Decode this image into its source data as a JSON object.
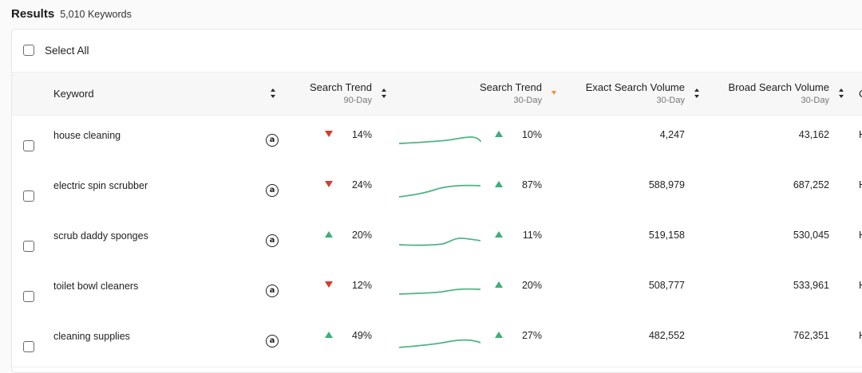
{
  "results": {
    "title": "Results",
    "count": "5,010 Keywords"
  },
  "select_all_label": "Select All",
  "columns": {
    "keyword": "Keyword",
    "trend90": {
      "label": "Search Trend",
      "sub": "90-Day"
    },
    "trend30": {
      "label": "Search Trend",
      "sub": "30-Day"
    },
    "exact": {
      "label": "Exact Search Volume",
      "sub": "30-Day"
    },
    "broad": {
      "label": "Broad Search Volume",
      "sub": "30-Day"
    },
    "cut_header": "C"
  },
  "amazon_glyph": "a",
  "icons": {
    "marketplace": "amazon-icon",
    "trend_down": "trend-down-icon",
    "trend_up": "trend-up-icon",
    "sort": "sort-icon"
  },
  "colors": {
    "up": "#3fae7a",
    "down": "#d63b30",
    "sparkline": "#4fb584",
    "sort_active": "#e8913c"
  },
  "rows": [
    {
      "keyword": "house cleaning",
      "trend90_dir": "down",
      "trend90": "14%",
      "trend30_dir": "up",
      "trend30": "10%",
      "exact": "4,247",
      "broad": "43,162",
      "cut": "H"
    },
    {
      "keyword": "electric spin scrubber",
      "trend90_dir": "down",
      "trend90": "24%",
      "trend30_dir": "up",
      "trend30": "87%",
      "exact": "588,979",
      "broad": "687,252",
      "cut": "H"
    },
    {
      "keyword": "scrub daddy sponges",
      "trend90_dir": "up",
      "trend90": "20%",
      "trend30_dir": "up",
      "trend30": "11%",
      "exact": "519,158",
      "broad": "530,045",
      "cut": "H"
    },
    {
      "keyword": "toilet bowl cleaners",
      "trend90_dir": "down",
      "trend90": "12%",
      "trend30_dir": "up",
      "trend30": "20%",
      "exact": "508,777",
      "broad": "533,961",
      "cut": "H"
    },
    {
      "keyword": "cleaning supplies",
      "trend90_dir": "up",
      "trend90": "49%",
      "trend30_dir": "up",
      "trend30": "27%",
      "exact": "482,552",
      "broad": "762,351",
      "cut": "H"
    }
  ]
}
